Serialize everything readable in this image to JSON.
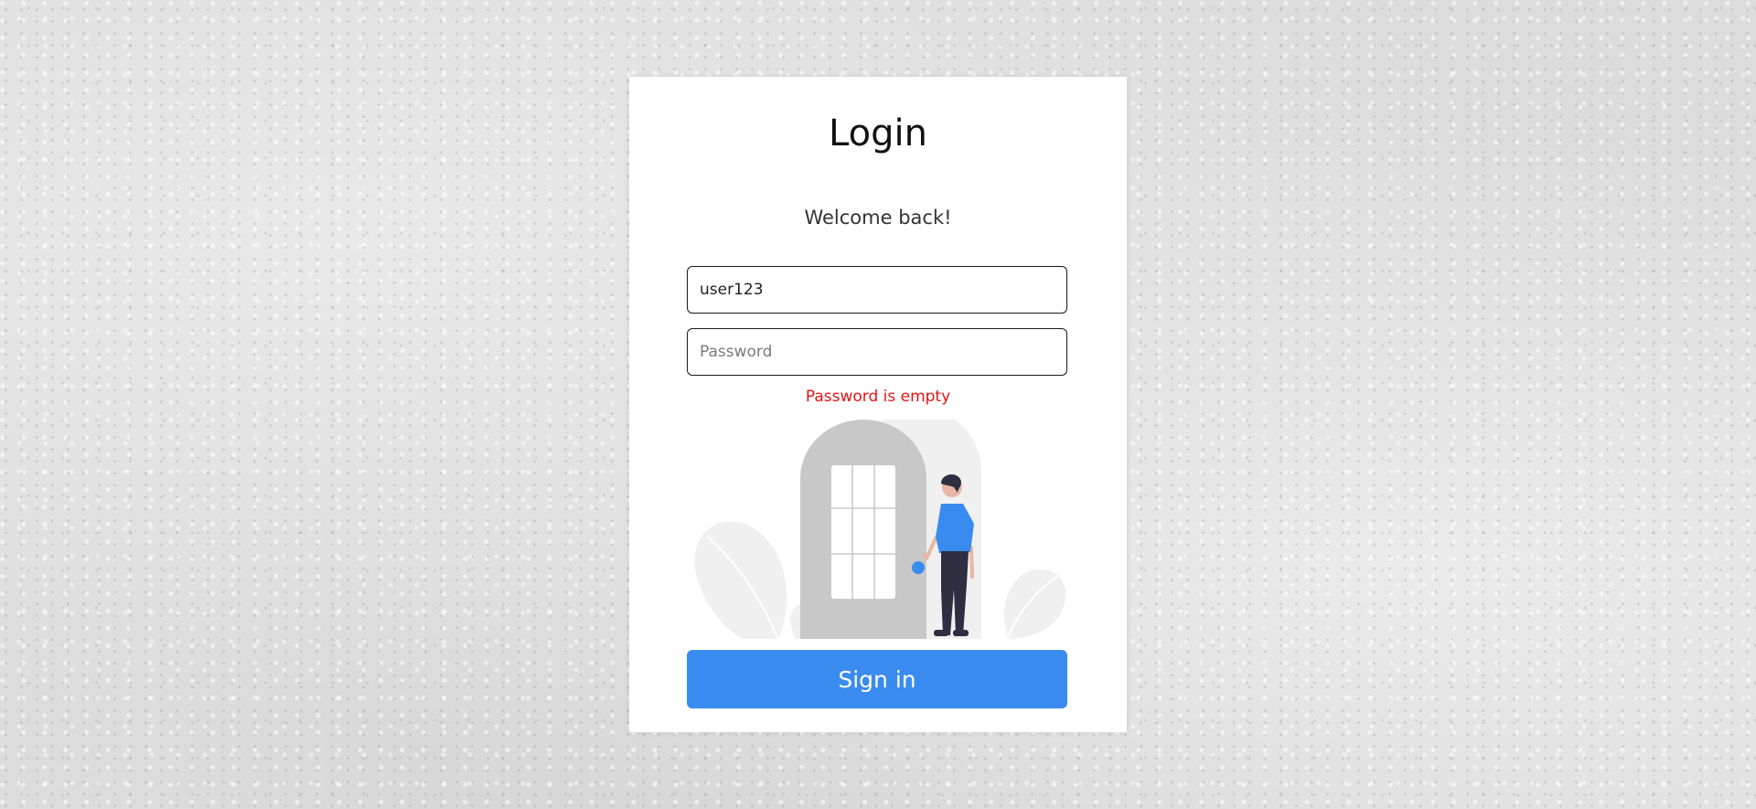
{
  "login": {
    "title": "Login",
    "subtitle": "Welcome back!",
    "username": {
      "value": "user123"
    },
    "password": {
      "value": "",
      "placeholder": "Password"
    },
    "error_message": "Password is empty",
    "submit_label": "Sign in"
  },
  "colors": {
    "primary_button": "#3a8bef",
    "error_text": "#e81111",
    "card_background": "#ffffff",
    "illustration_door": "#c8c8c8",
    "illustration_shirt": "#3a8bef"
  }
}
